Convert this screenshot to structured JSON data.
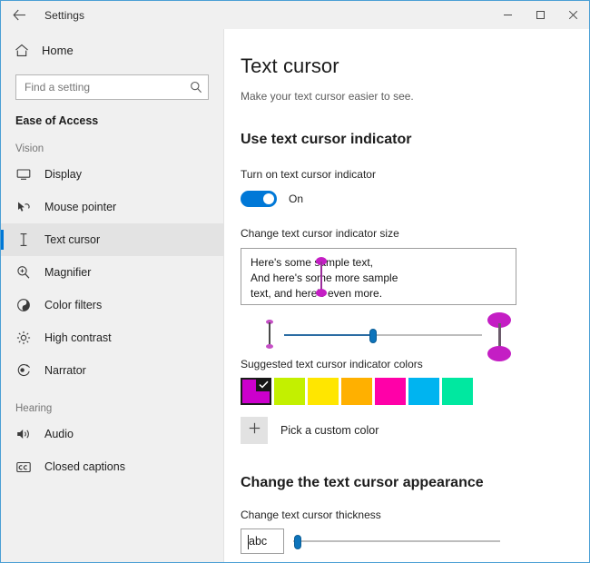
{
  "window": {
    "app_title": "Settings",
    "back_icon": "back-arrow-icon",
    "minimize_label": "–",
    "maximize_label": "☐",
    "close_label": "✕"
  },
  "sidebar": {
    "home_label": "Home",
    "home_icon": "home-icon",
    "search": {
      "placeholder": "Find a setting",
      "value": "",
      "icon": "search-icon"
    },
    "category_title": "Ease of Access",
    "groups": [
      {
        "heading": "Vision",
        "items": [
          {
            "label": "Display",
            "icon": "monitor-icon",
            "selected": false
          },
          {
            "label": "Mouse pointer",
            "icon": "mouse-pointer-icon",
            "selected": false
          },
          {
            "label": "Text cursor",
            "icon": "text-cursor-icon",
            "selected": true
          },
          {
            "label": "Magnifier",
            "icon": "magnifier-icon",
            "selected": false
          },
          {
            "label": "Color filters",
            "icon": "color-filters-icon",
            "selected": false
          },
          {
            "label": "High contrast",
            "icon": "high-contrast-icon",
            "selected": false
          },
          {
            "label": "Narrator",
            "icon": "narrator-icon",
            "selected": false
          }
        ]
      },
      {
        "heading": "Hearing",
        "items": [
          {
            "label": "Audio",
            "icon": "audio-icon",
            "selected": false
          },
          {
            "label": "Closed captions",
            "icon": "closed-captions-icon",
            "selected": false
          }
        ]
      }
    ]
  },
  "main": {
    "page_title": "Text cursor",
    "page_subtitle": "Make your text cursor easier to see.",
    "indicator_section": {
      "heading": "Use text cursor indicator",
      "toggle_label": "Turn on text cursor indicator",
      "toggle_state": "On",
      "toggle_on": true,
      "size_label": "Change text cursor indicator size",
      "sample_lines": [
        "Here's some sample text,",
        "And here's some more sample",
        "text, and here's even more."
      ],
      "size_slider": {
        "value_percent": 45,
        "min": 0,
        "max": 100,
        "fill_color": "#2b6ca3",
        "track_color": "#bdbdbd",
        "thumb_color": "#0d74bb"
      },
      "colors_label": "Suggested text cursor indicator colors",
      "swatches": [
        {
          "name": "magenta",
          "color": "#cc00cc",
          "selected": true
        },
        {
          "name": "yellow-green",
          "color": "#c3f000",
          "selected": false
        },
        {
          "name": "yellow",
          "color": "#ffe600",
          "selected": false
        },
        {
          "name": "orange",
          "color": "#ffb000",
          "selected": false
        },
        {
          "name": "pink",
          "color": "#ff00a8",
          "selected": false
        },
        {
          "name": "cyan",
          "color": "#00b4f0",
          "selected": false
        },
        {
          "name": "spring-green",
          "color": "#00e8a0",
          "selected": false
        }
      ],
      "custom_color_label": "Pick a custom color",
      "custom_color_icon": "plus-icon",
      "indicator_color": "#c41ec4"
    },
    "appearance_section": {
      "heading": "Change the text cursor appearance",
      "thickness_label": "Change text cursor thickness",
      "preview_text": "abc",
      "thickness_slider": {
        "value_percent": 2,
        "min": 0,
        "max": 100,
        "track_color": "#bdbdbd",
        "thumb_color": "#0d74bb"
      }
    }
  }
}
